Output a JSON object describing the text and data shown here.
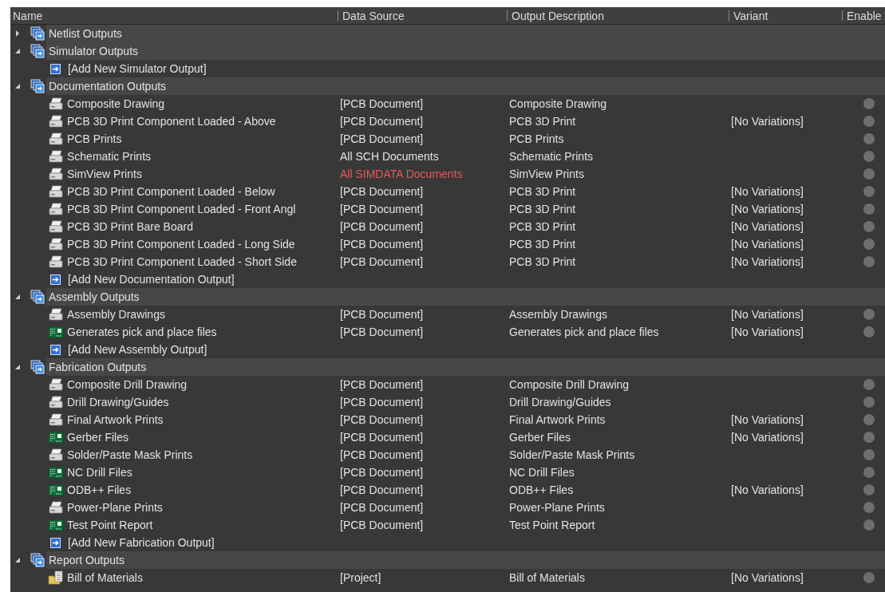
{
  "columns": [
    "Name",
    "Data Source",
    "Output Description",
    "Variant",
    "Enable"
  ],
  "groups": [
    {
      "name": "Netlist Outputs",
      "expanded": false
    },
    {
      "name": "Simulator Outputs",
      "expanded": true,
      "add": "[Add New Simulator Output]"
    },
    {
      "name": "Documentation Outputs",
      "expanded": true,
      "outputs": [
        {
          "kind": "print",
          "name": "Composite Drawing",
          "source": "[PCB Document]",
          "description": "Composite Drawing"
        },
        {
          "kind": "print",
          "name": "PCB 3D Print Component Loaded - Above",
          "source": "[PCB Document]",
          "description": "PCB 3D Print",
          "variant": "[No Variations]"
        },
        {
          "kind": "print",
          "name": "PCB Prints",
          "source": "[PCB Document]",
          "description": "PCB Prints"
        },
        {
          "kind": "print",
          "name": "Schematic Prints",
          "source": "All SCH Documents",
          "description": "Schematic Prints"
        },
        {
          "kind": "print",
          "name": "SimView Prints",
          "source": "All SIMDATA Documents",
          "source_error": true,
          "description": "SimView Prints"
        },
        {
          "kind": "print",
          "name": "PCB 3D Print Component Loaded - Below",
          "source": "[PCB Document]",
          "description": "PCB 3D Print",
          "variant": "[No Variations]"
        },
        {
          "kind": "print",
          "name": "PCB 3D Print Component Loaded - Front Angl",
          "source": "[PCB Document]",
          "description": "PCB 3D Print",
          "variant": "[No Variations]"
        },
        {
          "kind": "print",
          "name": "PCB 3D Print Bare Board",
          "source": "[PCB Document]",
          "description": "PCB 3D Print",
          "variant": "[No Variations]"
        },
        {
          "kind": "print",
          "name": "PCB 3D Print Component Loaded - Long Side",
          "source": "[PCB Document]",
          "description": "PCB 3D Print",
          "variant": "[No Variations]"
        },
        {
          "kind": "print",
          "name": "PCB 3D Print Component Loaded - Short Side",
          "source": "[PCB Document]",
          "description": "PCB 3D Print",
          "variant": "[No Variations]"
        }
      ],
      "add": "[Add New Documentation Output]"
    },
    {
      "name": "Assembly Outputs",
      "expanded": true,
      "outputs": [
        {
          "kind": "print",
          "name": "Assembly Drawings",
          "source": "[PCB Document]",
          "description": "Assembly Drawings",
          "variant": "[No Variations]"
        },
        {
          "kind": "board",
          "name": "Generates pick and place files",
          "source": "[PCB Document]",
          "description": "Generates pick and place files",
          "variant": "[No Variations]"
        }
      ],
      "add": "[Add New Assembly Output]"
    },
    {
      "name": "Fabrication Outputs",
      "expanded": true,
      "outputs": [
        {
          "kind": "print",
          "name": "Composite Drill Drawing",
          "source": "[PCB Document]",
          "description": "Composite Drill Drawing"
        },
        {
          "kind": "print",
          "name": "Drill Drawing/Guides",
          "source": "[PCB Document]",
          "description": "Drill Drawing/Guides"
        },
        {
          "kind": "print",
          "name": "Final Artwork Prints",
          "source": "[PCB Document]",
          "description": "Final Artwork Prints",
          "variant": "[No Variations]"
        },
        {
          "kind": "board",
          "name": "Gerber Files",
          "source": "[PCB Document]",
          "description": "Gerber Files",
          "variant": "[No Variations]"
        },
        {
          "kind": "print",
          "name": "Solder/Paste Mask Prints",
          "source": "[PCB Document]",
          "description": "Solder/Paste Mask Prints"
        },
        {
          "kind": "board",
          "name": "NC Drill Files",
          "source": "[PCB Document]",
          "description": "NC Drill Files"
        },
        {
          "kind": "board",
          "name": "ODB++ Files",
          "source": "[PCB Document]",
          "description": "ODB++ Files",
          "variant": "[No Variations]"
        },
        {
          "kind": "print",
          "name": "Power-Plane Prints",
          "source": "[PCB Document]",
          "description": "Power-Plane Prints"
        },
        {
          "kind": "board",
          "name": "Test Point Report",
          "source": "[PCB Document]",
          "description": "Test Point Report"
        }
      ],
      "add": "[Add New Fabrication Output]"
    },
    {
      "name": "Report Outputs",
      "expanded": true,
      "outputs": [
        {
          "kind": "report",
          "name": "Bill of Materials",
          "source": "[Project]",
          "description": "Bill of Materials",
          "variant": "[No Variations]"
        }
      ]
    }
  ]
}
